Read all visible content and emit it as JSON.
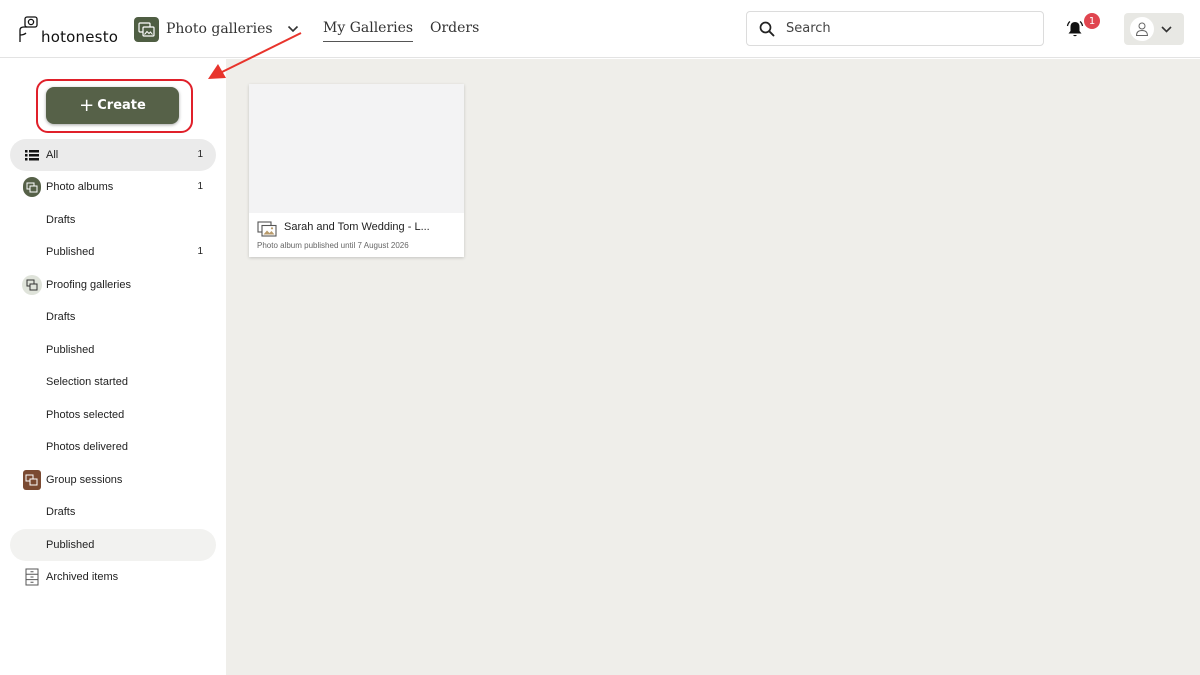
{
  "header": {
    "logo_text": "hotonesto",
    "product_label": "Photo galleries",
    "nav": [
      {
        "label": "My Galleries"
      },
      {
        "label": "Orders"
      }
    ],
    "search_placeholder": "Search",
    "notification_count": "1"
  },
  "sidebar": {
    "create_label": "Create",
    "items": [
      {
        "label": "All",
        "count": "1"
      },
      {
        "label": "Photo albums",
        "count": "1"
      },
      {
        "label": "Drafts"
      },
      {
        "label": "Published",
        "count": "1"
      },
      {
        "label": "Proofing galleries"
      },
      {
        "label": "Drafts"
      },
      {
        "label": "Published"
      },
      {
        "label": "Selection started"
      },
      {
        "label": "Photos selected"
      },
      {
        "label": "Photos delivered"
      },
      {
        "label": "Group sessions"
      },
      {
        "label": "Drafts"
      },
      {
        "label": "Published"
      },
      {
        "label": "Archived items"
      }
    ]
  },
  "main": {
    "cards": [
      {
        "title": "Sarah and Tom Wedding - London",
        "subtitle": "Photo album published until 7 August 2026"
      }
    ]
  },
  "colors": {
    "brand_green": "#566148",
    "group_brown": "#7a4a32",
    "highlight_red": "#e0202a",
    "badge_red": "#e0454f"
  }
}
